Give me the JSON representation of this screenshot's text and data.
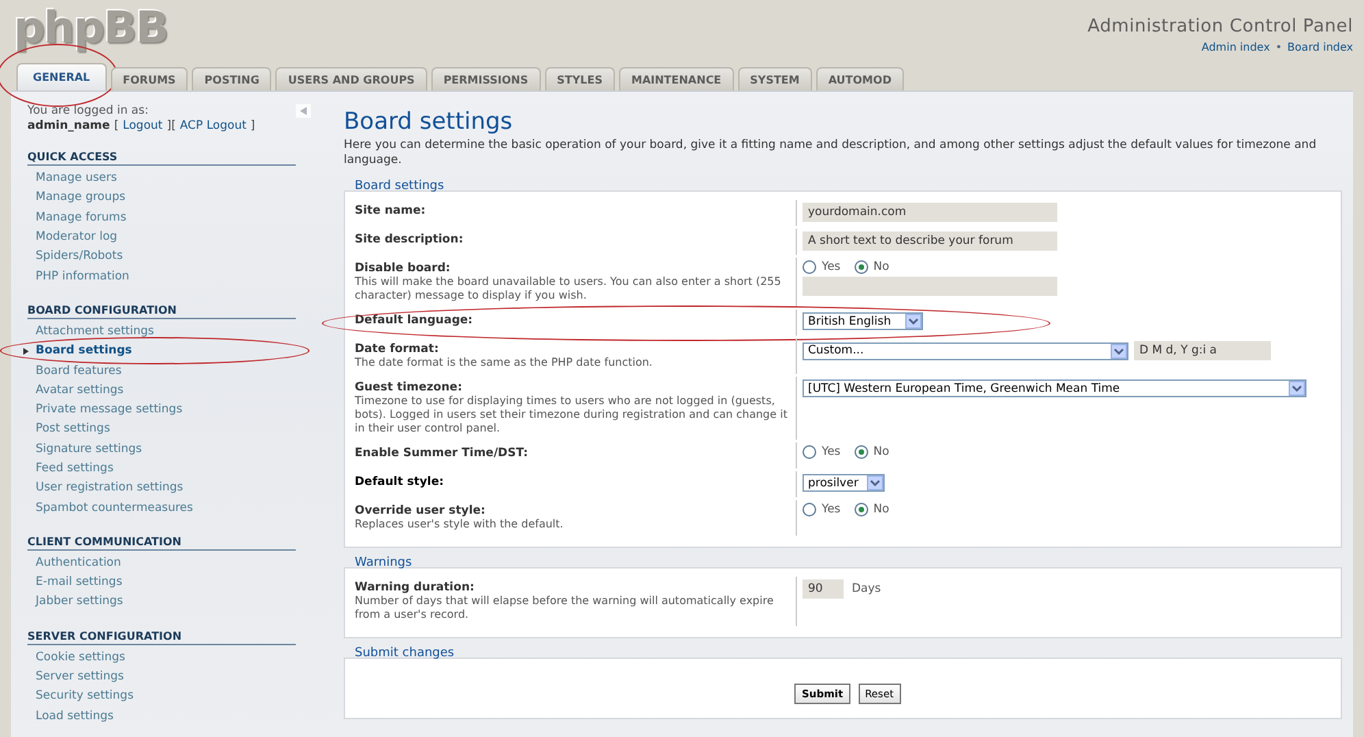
{
  "header": {
    "logo": "phpBB",
    "title": "Administration Control Panel",
    "links": [
      "Admin index",
      "Board index"
    ],
    "separator": "•"
  },
  "tabs": [
    {
      "label": "GENERAL",
      "selected": true,
      "circled": true
    },
    {
      "label": "FORUMS",
      "selected": false,
      "circled": false
    },
    {
      "label": "POSTING",
      "selected": false,
      "circled": false
    },
    {
      "label": "USERS AND GROUPS",
      "selected": false,
      "circled": false
    },
    {
      "label": "PERMISSIONS",
      "selected": false,
      "circled": false
    },
    {
      "label": "STYLES",
      "selected": false,
      "circled": false
    },
    {
      "label": "MAINTENANCE",
      "selected": false,
      "circled": false
    },
    {
      "label": "SYSTEM",
      "selected": false,
      "circled": false
    },
    {
      "label": "AUTOMOD",
      "selected": false,
      "circled": false
    }
  ],
  "sidebar": {
    "logged_in_text": "You are logged in as:",
    "username": "admin_name",
    "logout_links": [
      "Logout",
      "ACP Logout"
    ],
    "logout_brackets": [
      "[",
      "][",
      "]"
    ],
    "sections": [
      {
        "title": "QUICK ACCESS",
        "items": [
          {
            "label": "Manage users",
            "selected": false,
            "circled": false
          },
          {
            "label": "Manage groups",
            "selected": false,
            "circled": false
          },
          {
            "label": "Manage forums",
            "selected": false,
            "circled": false
          },
          {
            "label": "Moderator log",
            "selected": false,
            "circled": false
          },
          {
            "label": "Spiders/Robots",
            "selected": false,
            "circled": false
          },
          {
            "label": "PHP information",
            "selected": false,
            "circled": false
          }
        ]
      },
      {
        "title": "BOARD CONFIGURATION",
        "items": [
          {
            "label": "Attachment settings",
            "selected": false,
            "circled": false
          },
          {
            "label": "Board settings",
            "selected": true,
            "circled": true
          },
          {
            "label": "Board features",
            "selected": false,
            "circled": false
          },
          {
            "label": "Avatar settings",
            "selected": false,
            "circled": false
          },
          {
            "label": "Private message settings",
            "selected": false,
            "circled": false
          },
          {
            "label": "Post settings",
            "selected": false,
            "circled": false
          },
          {
            "label": "Signature settings",
            "selected": false,
            "circled": false
          },
          {
            "label": "Feed settings",
            "selected": false,
            "circled": false
          },
          {
            "label": "User registration settings",
            "selected": false,
            "circled": false
          },
          {
            "label": "Spambot countermeasures",
            "selected": false,
            "circled": false
          }
        ]
      },
      {
        "title": "CLIENT COMMUNICATION",
        "items": [
          {
            "label": "Authentication",
            "selected": false,
            "circled": false
          },
          {
            "label": "E-mail settings",
            "selected": false,
            "circled": false
          },
          {
            "label": "Jabber settings",
            "selected": false,
            "circled": false
          }
        ]
      },
      {
        "title": "SERVER CONFIGURATION",
        "items": [
          {
            "label": "Cookie settings",
            "selected": false,
            "circled": false
          },
          {
            "label": "Server settings",
            "selected": false,
            "circled": false
          },
          {
            "label": "Security settings",
            "selected": false,
            "circled": false
          },
          {
            "label": "Load settings",
            "selected": false,
            "circled": false
          }
        ]
      }
    ]
  },
  "main": {
    "title": "Board settings",
    "description": "Here you can determine the basic operation of your board, give it a fitting name and description, and among other settings adjust the default values for timezone and language.",
    "fieldsets": [
      {
        "legend": "Board settings",
        "fields": [
          {
            "kind": "text",
            "label": "Site name:",
            "value": "yourdomain.com",
            "circled": false
          },
          {
            "kind": "text",
            "label": "Site description:",
            "value": "A short text to describe your forum",
            "circled": false
          },
          {
            "kind": "radio_text",
            "label": "Disable board:",
            "description": "This will make the board unavailable to users. You can also enter a short (255 character) message to display if you wish.",
            "options": [
              {
                "label": "Yes",
                "selected": false
              },
              {
                "label": "No",
                "selected": true
              }
            ],
            "circled": false
          },
          {
            "kind": "select",
            "label": "Default language:",
            "value": "British English",
            "circled": true
          },
          {
            "kind": "select_text",
            "label": "Date format:",
            "description": "The date format is the same as the PHP date function.",
            "value": "Custom...",
            "extra": "D M d, Y g:i a",
            "circled": false
          },
          {
            "kind": "select_wide",
            "label": "Guest timezone:",
            "description": "Timezone to use for displaying times to users who are not logged in (guests, bots). Logged in users set their timezone during registration and can change it in their user control panel.",
            "value": "[UTC] Western European Time, Greenwich Mean Time",
            "circled": false
          },
          {
            "kind": "radio",
            "label": "Enable Summer Time/DST:",
            "options": [
              {
                "label": "Yes",
                "selected": false
              },
              {
                "label": "No",
                "selected": true
              }
            ],
            "circled": false
          },
          {
            "kind": "select",
            "label": "Default style:",
            "value": "prosilver",
            "circled": false
          },
          {
            "kind": "radio",
            "label": "Override user style:",
            "description": "Replaces user's style with the default.",
            "options": [
              {
                "label": "Yes",
                "selected": false
              },
              {
                "label": "No",
                "selected": true
              }
            ],
            "circled": false
          }
        ]
      },
      {
        "legend": "Warnings",
        "fields": [
          {
            "kind": "number",
            "label": "Warning duration:",
            "description": "Number of days that will elapse before the warning will automatically expire from a user's record.",
            "value": "90",
            "unit": "Days",
            "circled": false
          }
        ]
      }
    ],
    "submit": {
      "legend": "Submit changes",
      "buttons": [
        {
          "label": "Submit",
          "kind": "primary"
        },
        {
          "label": "Reset",
          "kind": "secondary"
        }
      ]
    }
  }
}
